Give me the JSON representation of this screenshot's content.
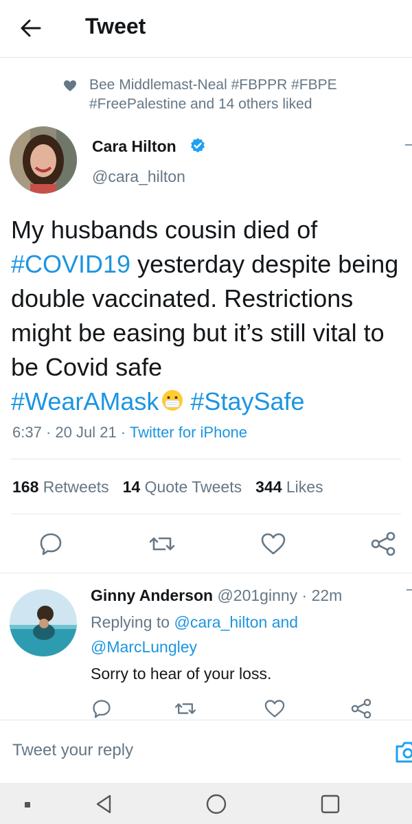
{
  "header": {
    "title": "Tweet"
  },
  "social_context": {
    "text": "Bee Middlemast-Neal #FBPPR #FBPE #FreePalestine and 14 others liked"
  },
  "tweet": {
    "author_name": "Cara Hilton",
    "author_handle": "@cara_hilton",
    "text_1": "My husbands cousin died of ",
    "hashtag_covid": "#COVID19",
    "text_2": " yesterday despite being double vaccinated. Restrictions might be easing but it’s still vital to be Covid safe ",
    "hashtag_mask": "#WearAMask",
    "hashtag_safe": "#StaySafe",
    "time": "6:37",
    "date": "20 Jul 21",
    "source": "Twitter for iPhone",
    "separator": " · "
  },
  "stats": {
    "retweets_count": "168",
    "retweets_label": "Retweets",
    "quotes_count": "14",
    "quotes_label": "Quote Tweets",
    "likes_count": "344",
    "likes_label": "Likes"
  },
  "reply": {
    "name": "Ginny Anderson",
    "handle_time": "@201ginny · 22m",
    "replying_prefix": "Replying to ",
    "replying_to_1": "@cara_hilton and",
    "replying_to_2": "@MarcLungley",
    "text": "Sorry to hear of your loss."
  },
  "compose": {
    "placeholder": "Tweet your reply"
  },
  "icons": [
    "arrow-left-icon",
    "heart-icon",
    "verified-badge-icon",
    "mask-emoji-icon",
    "reply-icon",
    "retweet-icon",
    "like-icon",
    "share-icon",
    "camera-icon"
  ],
  "colors": {
    "link": "#1b95e0",
    "secondary_text": "#657786",
    "primary_text": "#14171a",
    "divider": "#e1e8ed",
    "verified": "#1da1f2"
  }
}
